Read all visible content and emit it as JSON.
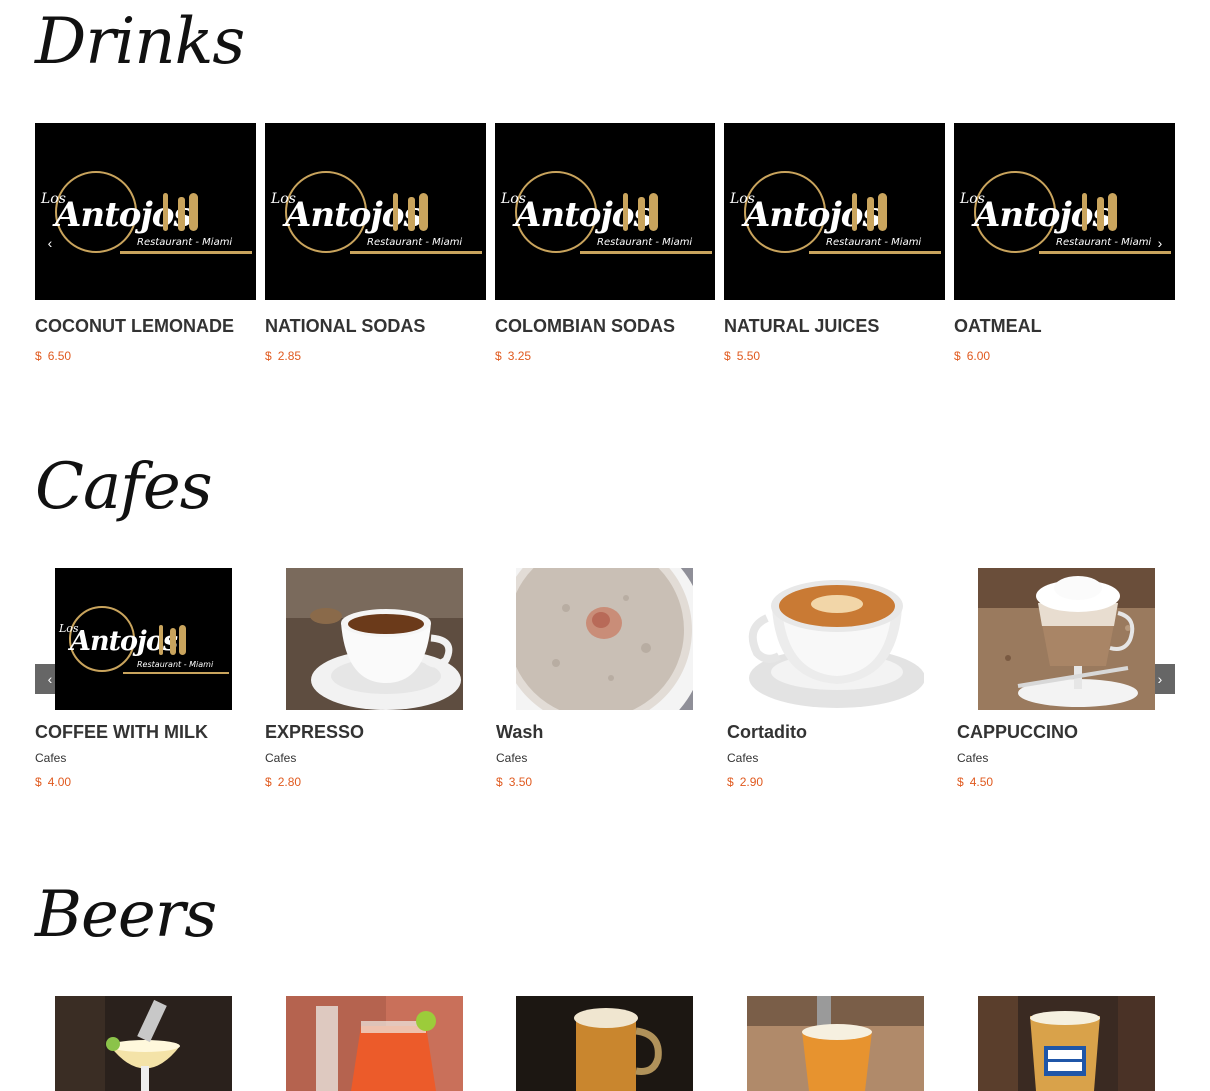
{
  "sections": {
    "drinks": {
      "title": "Drinks",
      "items": [
        {
          "name": "COCONUT LEMONADE",
          "currency": "$",
          "price": "6.50"
        },
        {
          "name": "NATIONAL SODAS",
          "currency": "$",
          "price": "2.85"
        },
        {
          "name": "COLOMBIAN SODAS",
          "currency": "$",
          "price": "3.25"
        },
        {
          "name": "NATURAL JUICES",
          "currency": "$",
          "price": "5.50"
        },
        {
          "name": "OATMEAL",
          "currency": "$",
          "price": "6.00"
        }
      ]
    },
    "cafes": {
      "title": "Cafes",
      "items": [
        {
          "name": "COFFEE WITH MILK",
          "category": "Cafes",
          "currency": "$",
          "price": "4.00"
        },
        {
          "name": "EXPRESSO",
          "category": "Cafes",
          "currency": "$",
          "price": "2.80"
        },
        {
          "name": "Wash",
          "category": "Cafes",
          "currency": "$",
          "price": "3.50"
        },
        {
          "name": "Cortadito",
          "category": "Cafes",
          "currency": "$",
          "price": "2.90"
        },
        {
          "name": "CAPPUCCINO",
          "category": "Cafes",
          "currency": "$",
          "price": "4.50"
        }
      ]
    },
    "beers": {
      "title": "Beers"
    }
  },
  "logo": {
    "los": "Los",
    "script": "Antojos",
    "sub": "Restaurant - Miami"
  },
  "carousel": {
    "prev": "‹",
    "next": "›"
  },
  "colors": {
    "accent": "#e05a1f",
    "gold": "#c9a45d"
  },
  "icons": [
    "chevron-left-icon",
    "chevron-right-icon"
  ]
}
